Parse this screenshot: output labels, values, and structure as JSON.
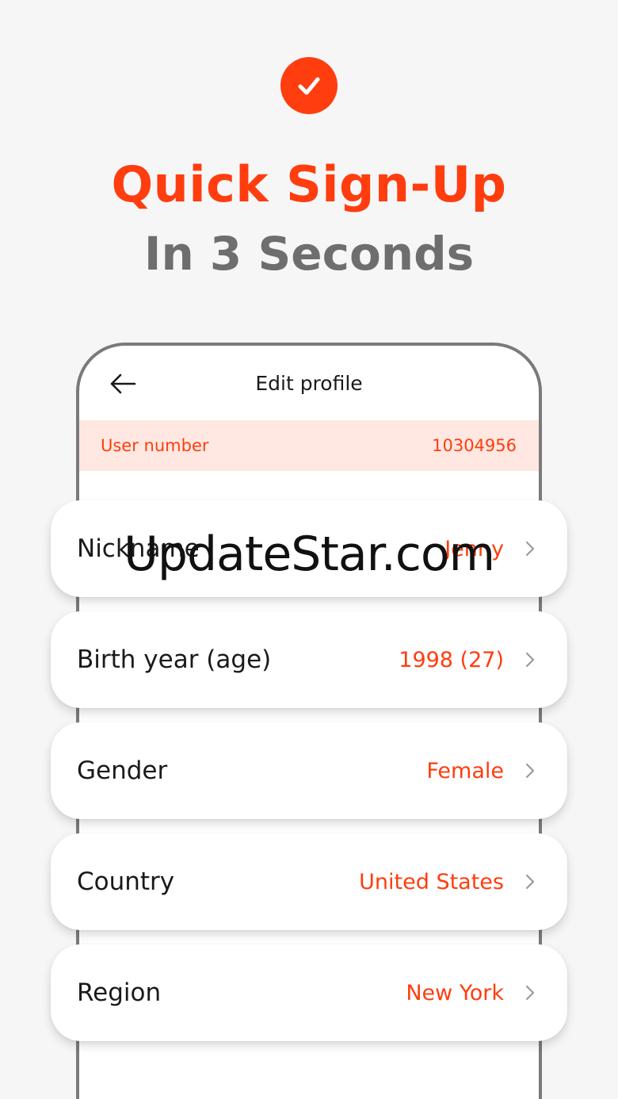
{
  "hero": {
    "title": "Quick Sign-Up",
    "subtitle": "In 3 Seconds"
  },
  "screen": {
    "header_title": "Edit profile",
    "user_number": {
      "label": "User number",
      "value": "10304956"
    }
  },
  "profile_rows": [
    {
      "label": "Nickname",
      "value": "Jenny"
    },
    {
      "label": "Birth year (age)",
      "value": "1998 (27)"
    },
    {
      "label": "Gender",
      "value": "Female"
    },
    {
      "label": "Country",
      "value": "United States"
    },
    {
      "label": "Region",
      "value": "New York"
    }
  ],
  "watermark": "UpdateStar.com",
  "colors": {
    "accent": "#ff3d0f",
    "subtitle_gray": "#6e6e6e",
    "user_bar_bg": "#ffe8e1",
    "background": "#f6f6f6"
  },
  "icons": {
    "badge": "check-icon",
    "back": "arrow-left-icon",
    "row": "chevron-right-icon"
  }
}
